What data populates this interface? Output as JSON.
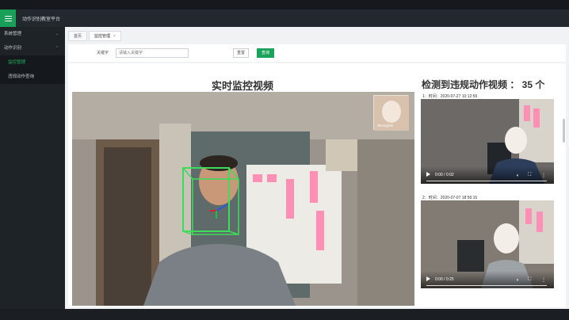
{
  "app": {
    "title": "动作识别教室平台"
  },
  "sidebar": {
    "groups": [
      {
        "label": "系统管理",
        "chevron": "chevron-down-icon"
      },
      {
        "label": "动作识别",
        "chevron": "chevron-up-icon"
      }
    ],
    "sub_items": [
      {
        "label": "监控管理"
      },
      {
        "label": "违规动作查询"
      }
    ]
  },
  "tabs": [
    {
      "label": "首页"
    },
    {
      "label": "监控管理",
      "close": "×"
    }
  ],
  "filter": {
    "keyword_label": "关键字",
    "keyword_placeholder": "请输入关键字",
    "reset_label": "重置",
    "search_label": "查询"
  },
  "live": {
    "title": "实时监控视频",
    "pip_label": "Zhongmei"
  },
  "detections": {
    "title": "检测到违规动作视频 ： 35 个",
    "items": [
      {
        "label": "1：时间：2020-07-27 10:12:59",
        "time": "0:00 / 0:02"
      },
      {
        "label": "2：时间：2020-07-07 18:56:16",
        "time": "0:00 / 0:25"
      }
    ]
  },
  "colors": {
    "accent": "#1aa35a",
    "sidebar_bg": "#1e2328",
    "box": "#3ddc5a"
  }
}
